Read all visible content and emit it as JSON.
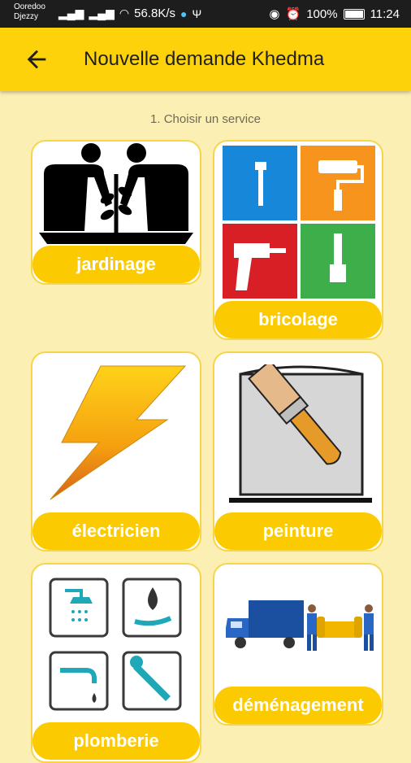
{
  "status_bar": {
    "carrier_1": "Ooredoo",
    "carrier_2": "Djezzy",
    "network_speed": "56.8K/s",
    "battery": "100%",
    "time": "11:24"
  },
  "app_bar": {
    "title": "Nouvelle demande Khedma"
  },
  "step": {
    "label": "1. Choisir un service"
  },
  "services": [
    {
      "label": "jardinage"
    },
    {
      "label": "bricolage"
    },
    {
      "label": "électricien"
    },
    {
      "label": "peinture"
    },
    {
      "label": "plomberie"
    },
    {
      "label": "déménagement"
    }
  ],
  "colors": {
    "background": "#fcefb3",
    "app_bar": "#fdd20a",
    "label_pill": "#fcca00",
    "card_border": "#f7d54a"
  }
}
